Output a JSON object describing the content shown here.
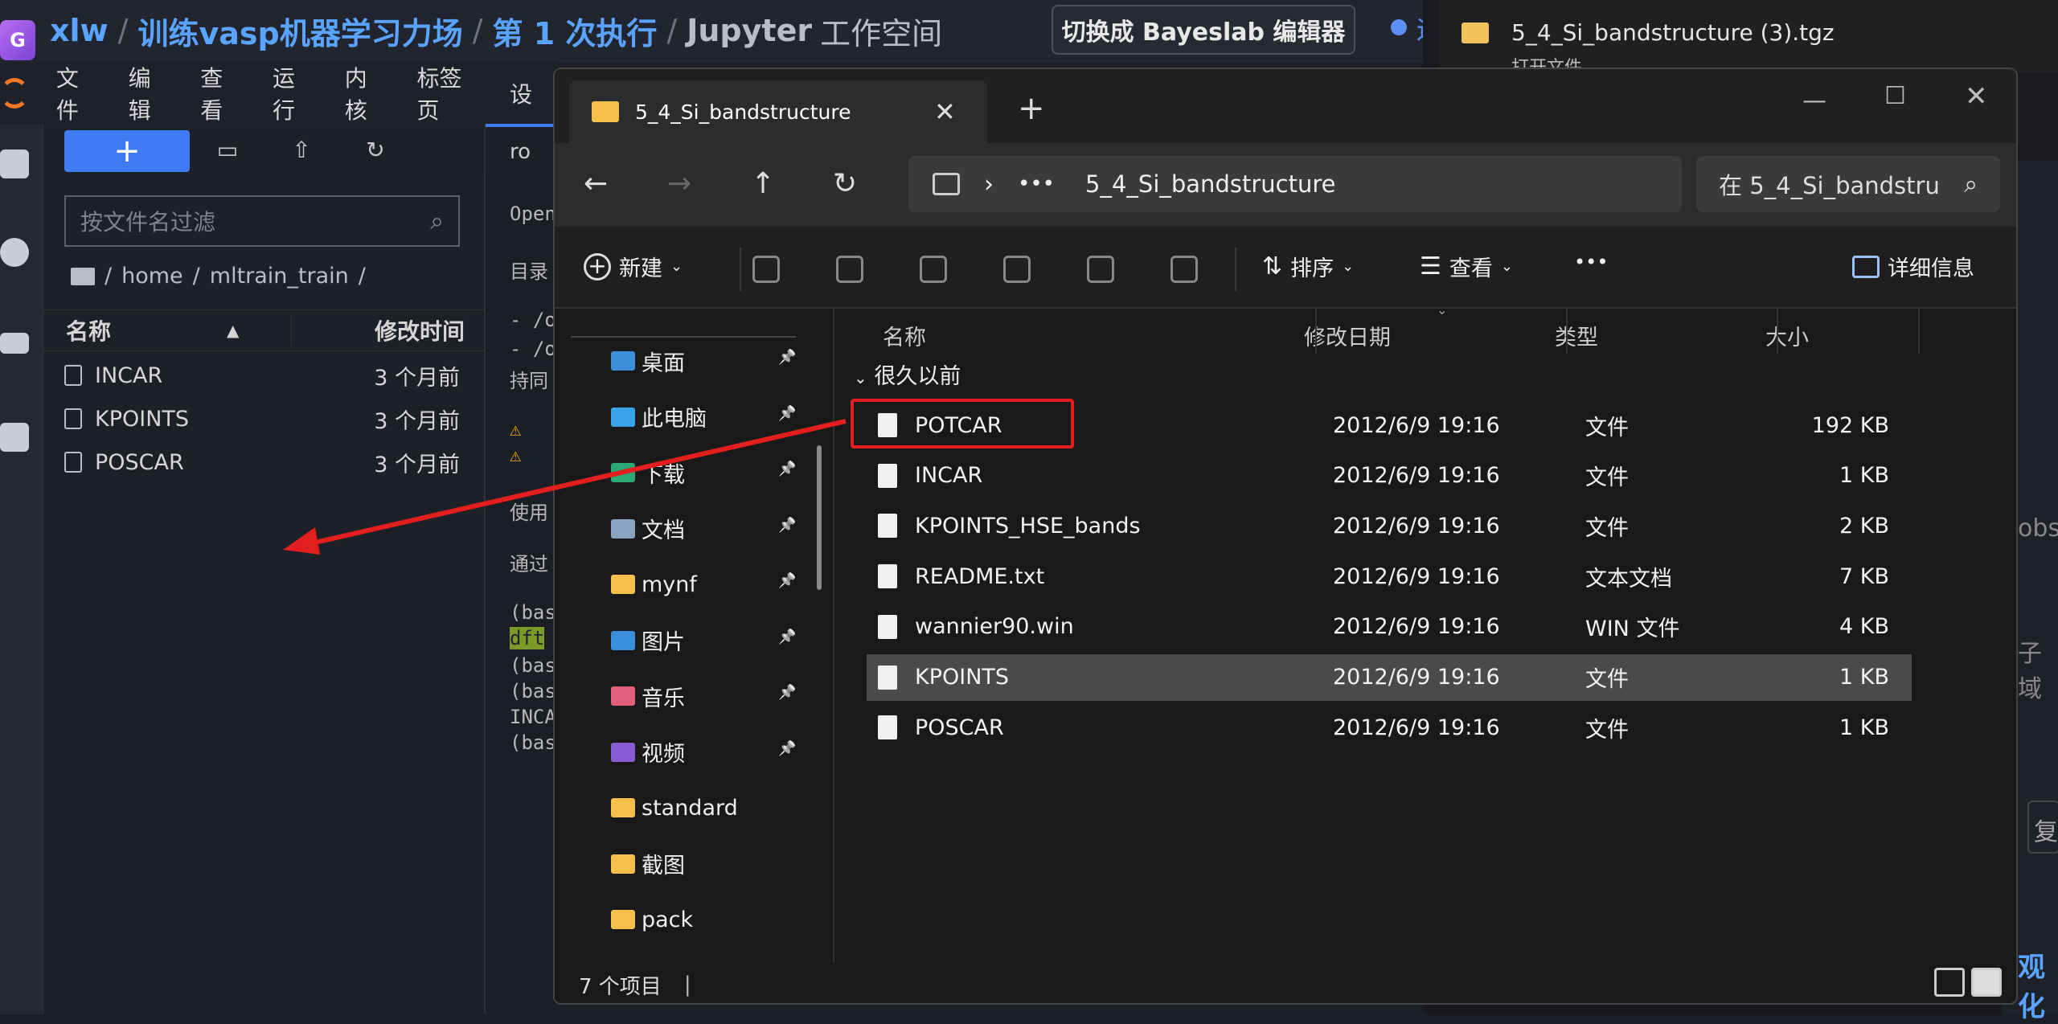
{
  "jupyter": {
    "breadcrumb": {
      "user": "xlw",
      "project": "训练vasp机器学习力场",
      "run": "第 1 次执行",
      "workspace_bold": "Jupyter",
      "workspace_rest": "工作空间"
    },
    "switch_editor_button": "切换成 Bayeslab 编辑器",
    "status_text": "运",
    "menu": [
      "文件",
      "编辑",
      "查看",
      "运行",
      "内核",
      "标签页",
      "设"
    ],
    "new_button_label": "+",
    "filter_placeholder": "按文件名过滤",
    "path": [
      "home",
      "mltrain_train"
    ],
    "columns": {
      "name": "名称",
      "modified": "修改时间"
    },
    "files": [
      {
        "name": "INCAR",
        "modified": "3 个月前"
      },
      {
        "name": "KPOINTS",
        "modified": "3 个月前"
      },
      {
        "name": "POSCAR",
        "modified": "3 个月前"
      }
    ],
    "tab_label": "ro",
    "terminal_lines": [
      "Open",
      "目录",
      "- /o",
      "- /o",
      "持同",
      "⚠ ",
      "⚠ ",
      "使用",
      "通过",
      "(bas",
      "dft",
      "(bas",
      "(bas",
      "INCA",
      "(bas"
    ]
  },
  "download": {
    "file_name": "5_4_Si_bandstructure (3).tgz",
    "sub_text": "打开文件"
  },
  "right_fragments": {
    "a": "obs/",
    "b": "子域",
    "c": "复",
    "d": "观化"
  },
  "explorer": {
    "tab_title": "5_4_Si_bandstructure",
    "address_current": "5_4_Si_bandstructure",
    "search_placeholder": "在 5_4_Si_bandstru",
    "commands": {
      "new": "新建",
      "sort": "排序",
      "view": "查看",
      "more": "•••",
      "details": "详细信息"
    },
    "nav_items": [
      {
        "label": "桌面",
        "color": "#3b8fd9",
        "pinned": true
      },
      {
        "label": "此电脑",
        "color": "#3aa3e8",
        "pinned": true
      },
      {
        "label": "下载",
        "color": "#2aa876",
        "pinned": true
      },
      {
        "label": "文档",
        "color": "#8aa2c2",
        "pinned": true
      },
      {
        "label": "mynf",
        "color": "#f5c04a",
        "pinned": true
      },
      {
        "label": "图片",
        "color": "#3a8fdc",
        "pinned": true
      },
      {
        "label": "音乐",
        "color": "#e0607a",
        "pinned": true
      },
      {
        "label": "视频",
        "color": "#8b5bd6",
        "pinned": true
      },
      {
        "label": "standard",
        "color": "#f5c04a",
        "pinned": false
      },
      {
        "label": "截图",
        "color": "#f5c04a",
        "pinned": false
      },
      {
        "label": "pack",
        "color": "#f5c04a",
        "pinned": false
      }
    ],
    "columns": {
      "name": "名称",
      "date": "修改日期",
      "type": "类型",
      "size": "大小"
    },
    "group_label": "很久以前",
    "files": [
      {
        "name": "POTCAR",
        "date": "2012/6/9 19:16",
        "type": "文件",
        "size": "192 KB"
      },
      {
        "name": "INCAR",
        "date": "2012/6/9 19:16",
        "type": "文件",
        "size": "1 KB"
      },
      {
        "name": "KPOINTS_HSE_bands",
        "date": "2012/6/9 19:16",
        "type": "文件",
        "size": "2 KB"
      },
      {
        "name": "README.txt",
        "date": "2012/6/9 19:16",
        "type": "文本文档",
        "size": "7 KB"
      },
      {
        "name": "wannier90.win",
        "date": "2012/6/9 19:16",
        "type": "WIN 文件",
        "size": "4 KB"
      },
      {
        "name": "KPOINTS",
        "date": "2012/6/9 19:16",
        "type": "文件",
        "size": "1 KB"
      },
      {
        "name": "POSCAR",
        "date": "2012/6/9 19:16",
        "type": "文件",
        "size": "1 KB"
      }
    ],
    "selected_file": "KPOINTS",
    "highlighted_file": "POTCAR",
    "status_count": "7 个项目"
  },
  "colors": {
    "accent_blue": "#3e7bf2",
    "annotation_red": "#e21e1e",
    "folder_yellow": "#f5c04a"
  }
}
